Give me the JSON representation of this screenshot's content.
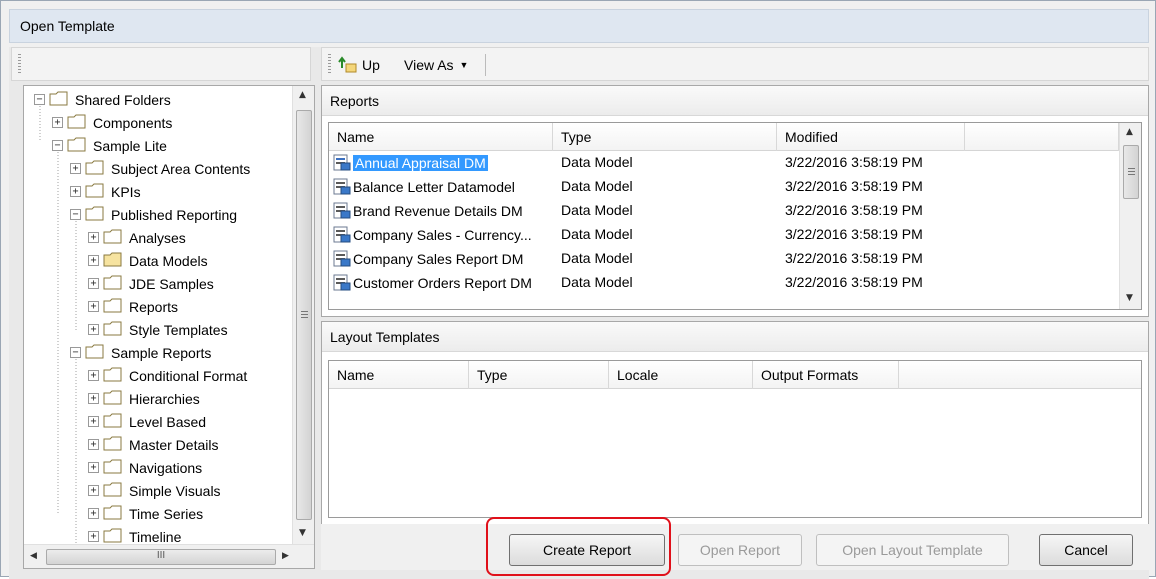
{
  "window": {
    "title": "Open Template"
  },
  "toolbar": {
    "up_label": "Up",
    "view_as_label": "View As"
  },
  "tree": {
    "nodes": [
      {
        "label": "Shared Folders",
        "expander": "−"
      },
      {
        "label": "Components",
        "expander": "+"
      },
      {
        "label": "Sample Lite",
        "expander": "−"
      },
      {
        "label": "Subject Area Contents",
        "expander": "+"
      },
      {
        "label": "KPIs",
        "expander": "+"
      },
      {
        "label": "Published Reporting",
        "expander": "−"
      },
      {
        "label": "Analyses",
        "expander": "+"
      },
      {
        "label": "Data Models",
        "expander": "+"
      },
      {
        "label": "JDE Samples",
        "expander": "+"
      },
      {
        "label": "Reports",
        "expander": "+"
      },
      {
        "label": "Style Templates",
        "expander": "+"
      },
      {
        "label": "Sample Reports",
        "expander": "−"
      },
      {
        "label": "Conditional Format",
        "expander": "+"
      },
      {
        "label": "Hierarchies",
        "expander": "+"
      },
      {
        "label": "Level Based",
        "expander": "+"
      },
      {
        "label": "Master Details",
        "expander": "+"
      },
      {
        "label": "Navigations",
        "expander": "+"
      },
      {
        "label": "Simple Visuals",
        "expander": "+"
      },
      {
        "label": "Time Series",
        "expander": "+"
      },
      {
        "label": "Timeline",
        "expander": "+"
      }
    ],
    "hscroll_grip": "III"
  },
  "reports": {
    "header": "Reports",
    "columns": [
      "Name",
      "Type",
      "Modified"
    ],
    "rows": [
      {
        "name": "Annual Appraisal DM",
        "type": "Data Model",
        "modified": "3/22/2016 3:58:19 PM"
      },
      {
        "name": "Balance Letter Datamodel",
        "type": "Data Model",
        "modified": "3/22/2016 3:58:19 PM"
      },
      {
        "name": "Brand Revenue Details DM",
        "type": "Data Model",
        "modified": "3/22/2016 3:58:19 PM"
      },
      {
        "name": "Company Sales - Currency...",
        "type": "Data Model",
        "modified": "3/22/2016 3:58:19 PM"
      },
      {
        "name": "Company Sales Report DM",
        "type": "Data Model",
        "modified": "3/22/2016 3:58:19 PM"
      },
      {
        "name": "Customer Orders Report DM",
        "type": "Data Model",
        "modified": "3/22/2016 3:58:19 PM"
      }
    ]
  },
  "layout_templates": {
    "header": "Layout Templates",
    "columns": [
      "Name",
      "Type",
      "Locale",
      "Output Formats"
    ]
  },
  "buttons": {
    "create_report": "Create Report",
    "open_report": "Open Report",
    "open_layout_template": "Open Layout Template",
    "cancel": "Cancel"
  },
  "colors": {
    "highlight": "#e0101a",
    "selection": "#3399ff"
  }
}
